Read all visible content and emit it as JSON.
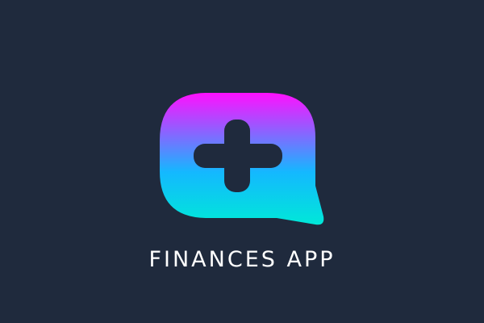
{
  "app": {
    "name": "FINANCES APP"
  },
  "logo": {
    "icon": "speech-bubble-plus-icon",
    "gradient_top": "#ff10ff",
    "gradient_mid": "#14b8ff",
    "gradient_bottom": "#00e8d8",
    "cutout_color": "#1f2a3d"
  },
  "background_color": "#1f2a3d"
}
